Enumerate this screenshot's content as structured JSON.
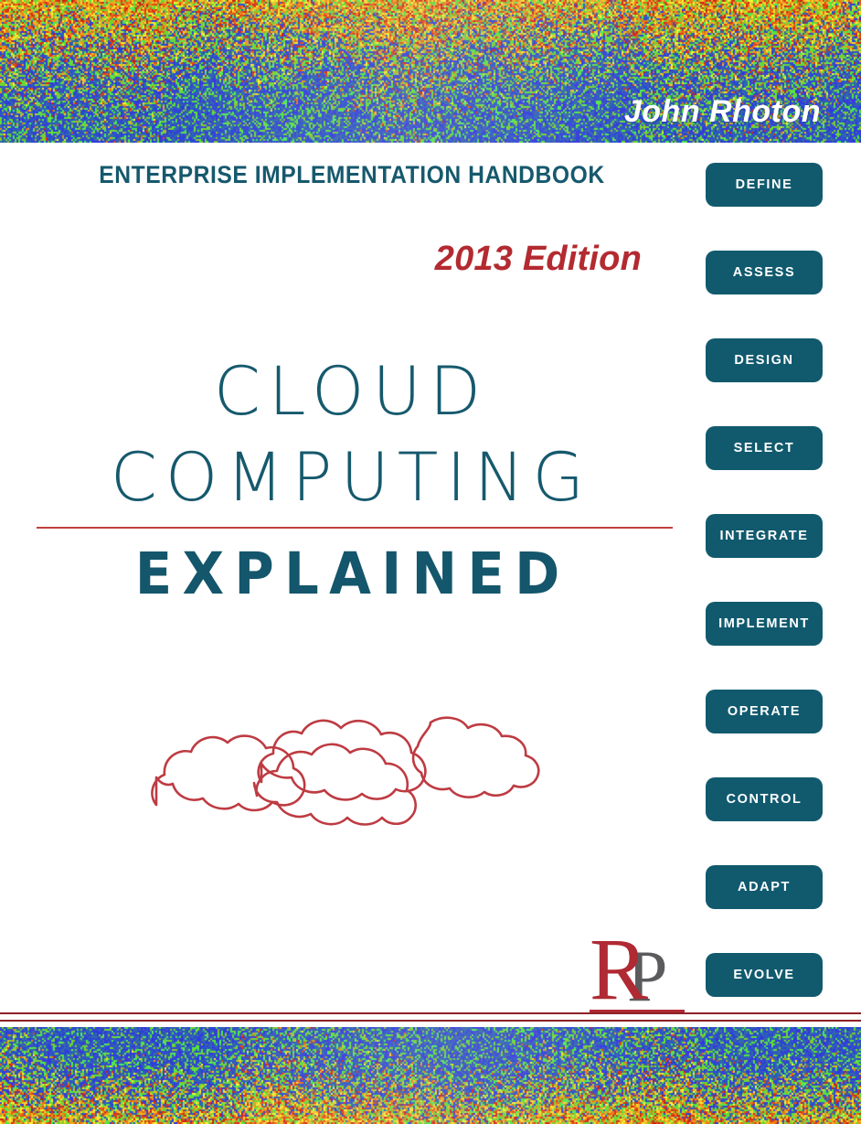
{
  "cover": {
    "author": "John Rhoton",
    "subtitle": "ENTERPRISE IMPLEMENTATION HANDBOOK",
    "edition": "2013 Edition",
    "title_line1": "CLOUD",
    "title_line2": "COMPUTING",
    "title_emphasis": "EXPLAINED",
    "illustration": "four-overlapping-clouds-outline"
  },
  "publisher_logo": {
    "letter_primary": "R",
    "letter_secondary": "P"
  },
  "badges": [
    {
      "label": "DEFINE"
    },
    {
      "label": "ASSESS"
    },
    {
      "label": "DESIGN"
    },
    {
      "label": "SELECT"
    },
    {
      "label": "INTEGRATE"
    },
    {
      "label": "IMPLEMENT"
    },
    {
      "label": "OPERATE"
    },
    {
      "label": "CONTROL"
    },
    {
      "label": "ADAPT"
    },
    {
      "label": "EVOLVE"
    }
  ],
  "colors": {
    "teal": "#16596D",
    "badge_fill": "#115A6E",
    "red": "#B32A30",
    "rule_red": "#C1403F",
    "logo_red": "#B02A33",
    "logo_gray": "#5B5B5D",
    "background": "#FFFFFF"
  }
}
